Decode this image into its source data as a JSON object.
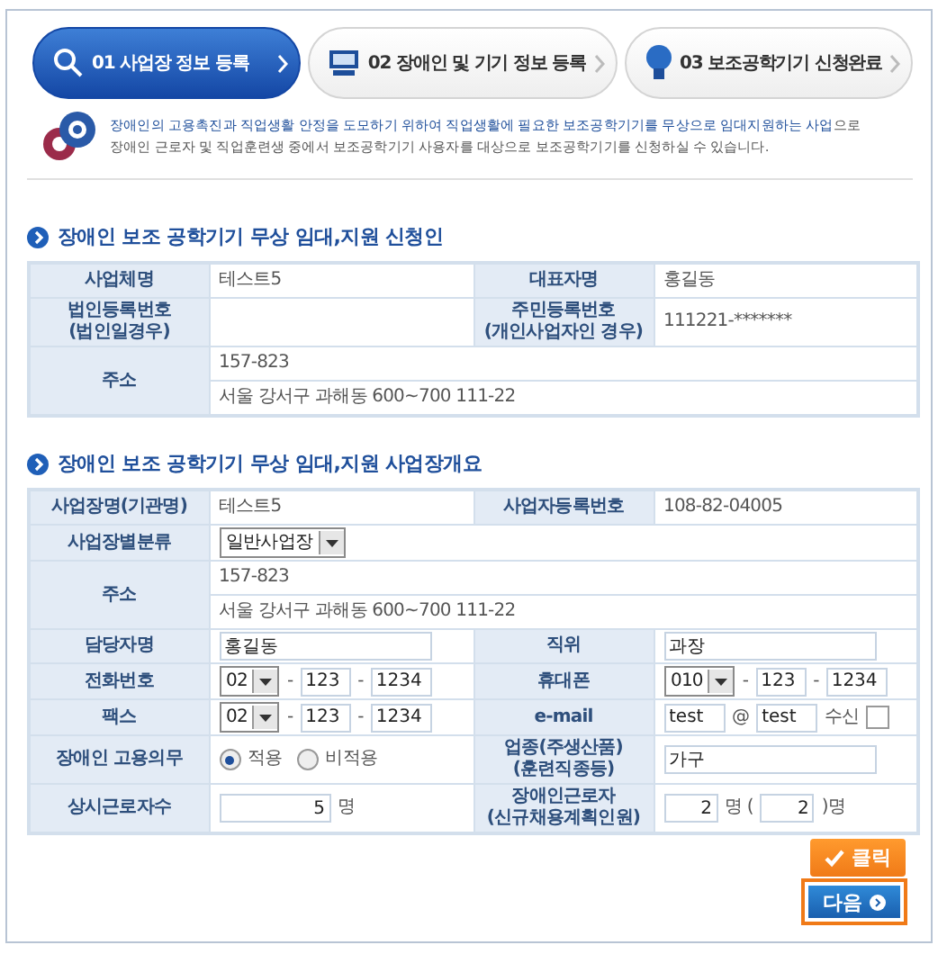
{
  "steps": [
    {
      "number": "01",
      "label": "사업장 정보 등록",
      "selected": true
    },
    {
      "number": "02",
      "label": "장애인 및 기기 정보 등록",
      "selected": false
    },
    {
      "number": "03",
      "label": "보조공학기기 신청완료",
      "selected": false
    }
  ],
  "intro": {
    "line1": "**장애인의 고용촉진과 직업생활 안정을 도모하기 위하여 직업생활에 필요한 보조공학기기를 무상으로 임대지원하는 사업**으로",
    "line2": "장애인 근로자 및 직업훈련생 중에서 보조공학기기 사용자를 대상으로 보조공학기기를 신청하실 수 있습니다."
  },
  "sections": [
    {
      "title": "장애인 보조 공학기기 무상 임대,지원 신청인",
      "rows": [
        {
          "kind": "pair",
          "cells": [
            {
              "label": [
                "사업체명"
              ]
            },
            {
              "parts": [
                {
                  "kind": "text",
                  "text": "테스트5"
                }
              ]
            },
            {
              "label": [
                "대표자명"
              ]
            },
            {
              "parts": [
                {
                  "kind": "text",
                  "text": "홍길동"
                }
              ]
            }
          ]
        },
        {
          "kind": "pair",
          "cells": [
            {
              "label": [
                "법인등록번호",
                "(법인일경우)"
              ]
            },
            {},
            {
              "label": [
                "주민등록번호",
                "(개인사업자인 경우)"
              ]
            },
            {
              "parts": [
                {
                  "kind": "text",
                  "text": "111221-*******"
                }
              ]
            }
          ]
        },
        {
          "kind": "address",
          "label": [
            "주소"
          ],
          "lines": [
            "157-823",
            "서울 강서구 과해동 600~700 111-22"
          ]
        }
      ]
    },
    {
      "title": "장애인 보조 공학기기 무상 임대,지원 사업장개요",
      "rows": [
        {
          "kind": "pair",
          "cells": [
            {
              "label": [
                "사업장명(기관명)"
              ]
            },
            {
              "parts": [
                {
                  "kind": "text",
                  "text": "테스트5"
                }
              ]
            },
            {
              "label": [
                "사업자등록번호"
              ]
            },
            {
              "parts": [
                {
                  "kind": "text",
                  "text": "108-82-04005"
                }
              ]
            }
          ]
        },
        {
          "kind": "wide",
          "cells": [
            {
              "label": [
                "사업장별분류"
              ]
            },
            {
              "parts": [
                {
                  "kind": "select",
                  "value": "일반사업장"
                }
              ]
            }
          ]
        },
        {
          "kind": "address",
          "label": [
            "주소"
          ],
          "lines": [
            "157-823",
            "서울 강서구 과해동 600~700 111-22"
          ]
        },
        {
          "kind": "pair",
          "cells": [
            {
              "label": [
                "담당자명"
              ]
            },
            {
              "parts": [
                {
                  "kind": "field",
                  "value": "홍길동"
                }
              ]
            },
            {
              "label": [
                "직위"
              ]
            },
            {
              "parts": [
                {
                  "kind": "field",
                  "value": "과장"
                }
              ]
            }
          ]
        },
        {
          "kind": "pair",
          "cells": [
            {
              "label": [
                "전화번호"
              ]
            },
            {
              "parts": [
                {
                  "kind": "select",
                  "value": "02"
                },
                {
                  "kind": "text",
                  "text": "-"
                },
                {
                  "kind": "short",
                  "value": "123"
                },
                {
                  "kind": "text",
                  "text": "-"
                },
                {
                  "kind": "short",
                  "value": "1234"
                }
              ]
            },
            {
              "label": [
                "휴대폰"
              ]
            },
            {
              "parts": [
                {
                  "kind": "select",
                  "value": "010"
                },
                {
                  "kind": "text",
                  "text": "-"
                },
                {
                  "kind": "short",
                  "value": "123"
                },
                {
                  "kind": "text",
                  "text": "-"
                },
                {
                  "kind": "short",
                  "value": "1234"
                }
              ]
            }
          ]
        },
        {
          "kind": "pair",
          "cells": [
            {
              "label": [
                "팩스"
              ]
            },
            {
              "parts": [
                {
                  "kind": "select",
                  "value": "02"
                },
                {
                  "kind": "text",
                  "text": "-"
                },
                {
                  "kind": "short",
                  "value": "123"
                },
                {
                  "kind": "text",
                  "text": "-"
                },
                {
                  "kind": "short",
                  "value": "1234"
                }
              ]
            },
            {
              "label": [
                "e-mail"
              ]
            },
            {
              "parts": [
                {
                  "kind": "short",
                  "value": "test"
                },
                {
                  "kind": "text",
                  "text": "@"
                },
                {
                  "kind": "short",
                  "value": "test"
                },
                {
                  "kind": "text",
                  "text": "수신"
                },
                {
                  "kind": "checkbox",
                  "checked": false
                }
              ]
            }
          ]
        },
        {
          "kind": "pair",
          "cells": [
            {
              "label": [
                "장애인 고용의무"
              ]
            },
            {
              "parts": [
                {
                  "kind": "radio",
                  "label": "적용",
                  "selected": true
                },
                {
                  "kind": "radio",
                  "label": "비적용",
                  "selected": false
                }
              ]
            },
            {
              "label": [
                "업종(주생산품)",
                "(훈련직종등)"
              ]
            },
            {
              "parts": [
                {
                  "kind": "field",
                  "value": "가구"
                }
              ]
            }
          ]
        },
        {
          "kind": "pair",
          "cells": [
            {
              "label": [
                "상시근로자수"
              ]
            },
            {
              "parts": [
                {
                  "kind": "amount",
                  "value": "5"
                },
                {
                  "kind": "text",
                  "text": "명"
                }
              ]
            },
            {
              "label": [
                "장애인근로자",
                "(신규채용계획인원)"
              ]
            },
            {
              "parts": [
                {
                  "kind": "count",
                  "value": "2"
                },
                {
                  "kind": "text",
                  "text": "명 ("
                },
                {
                  "kind": "count",
                  "value": "2"
                },
                {
                  "kind": "text",
                  "text": ")명"
                }
              ]
            }
          ]
        }
      ]
    }
  ],
  "next_button": {
    "label": "다음"
  },
  "callout": {
    "label": "클릭"
  }
}
